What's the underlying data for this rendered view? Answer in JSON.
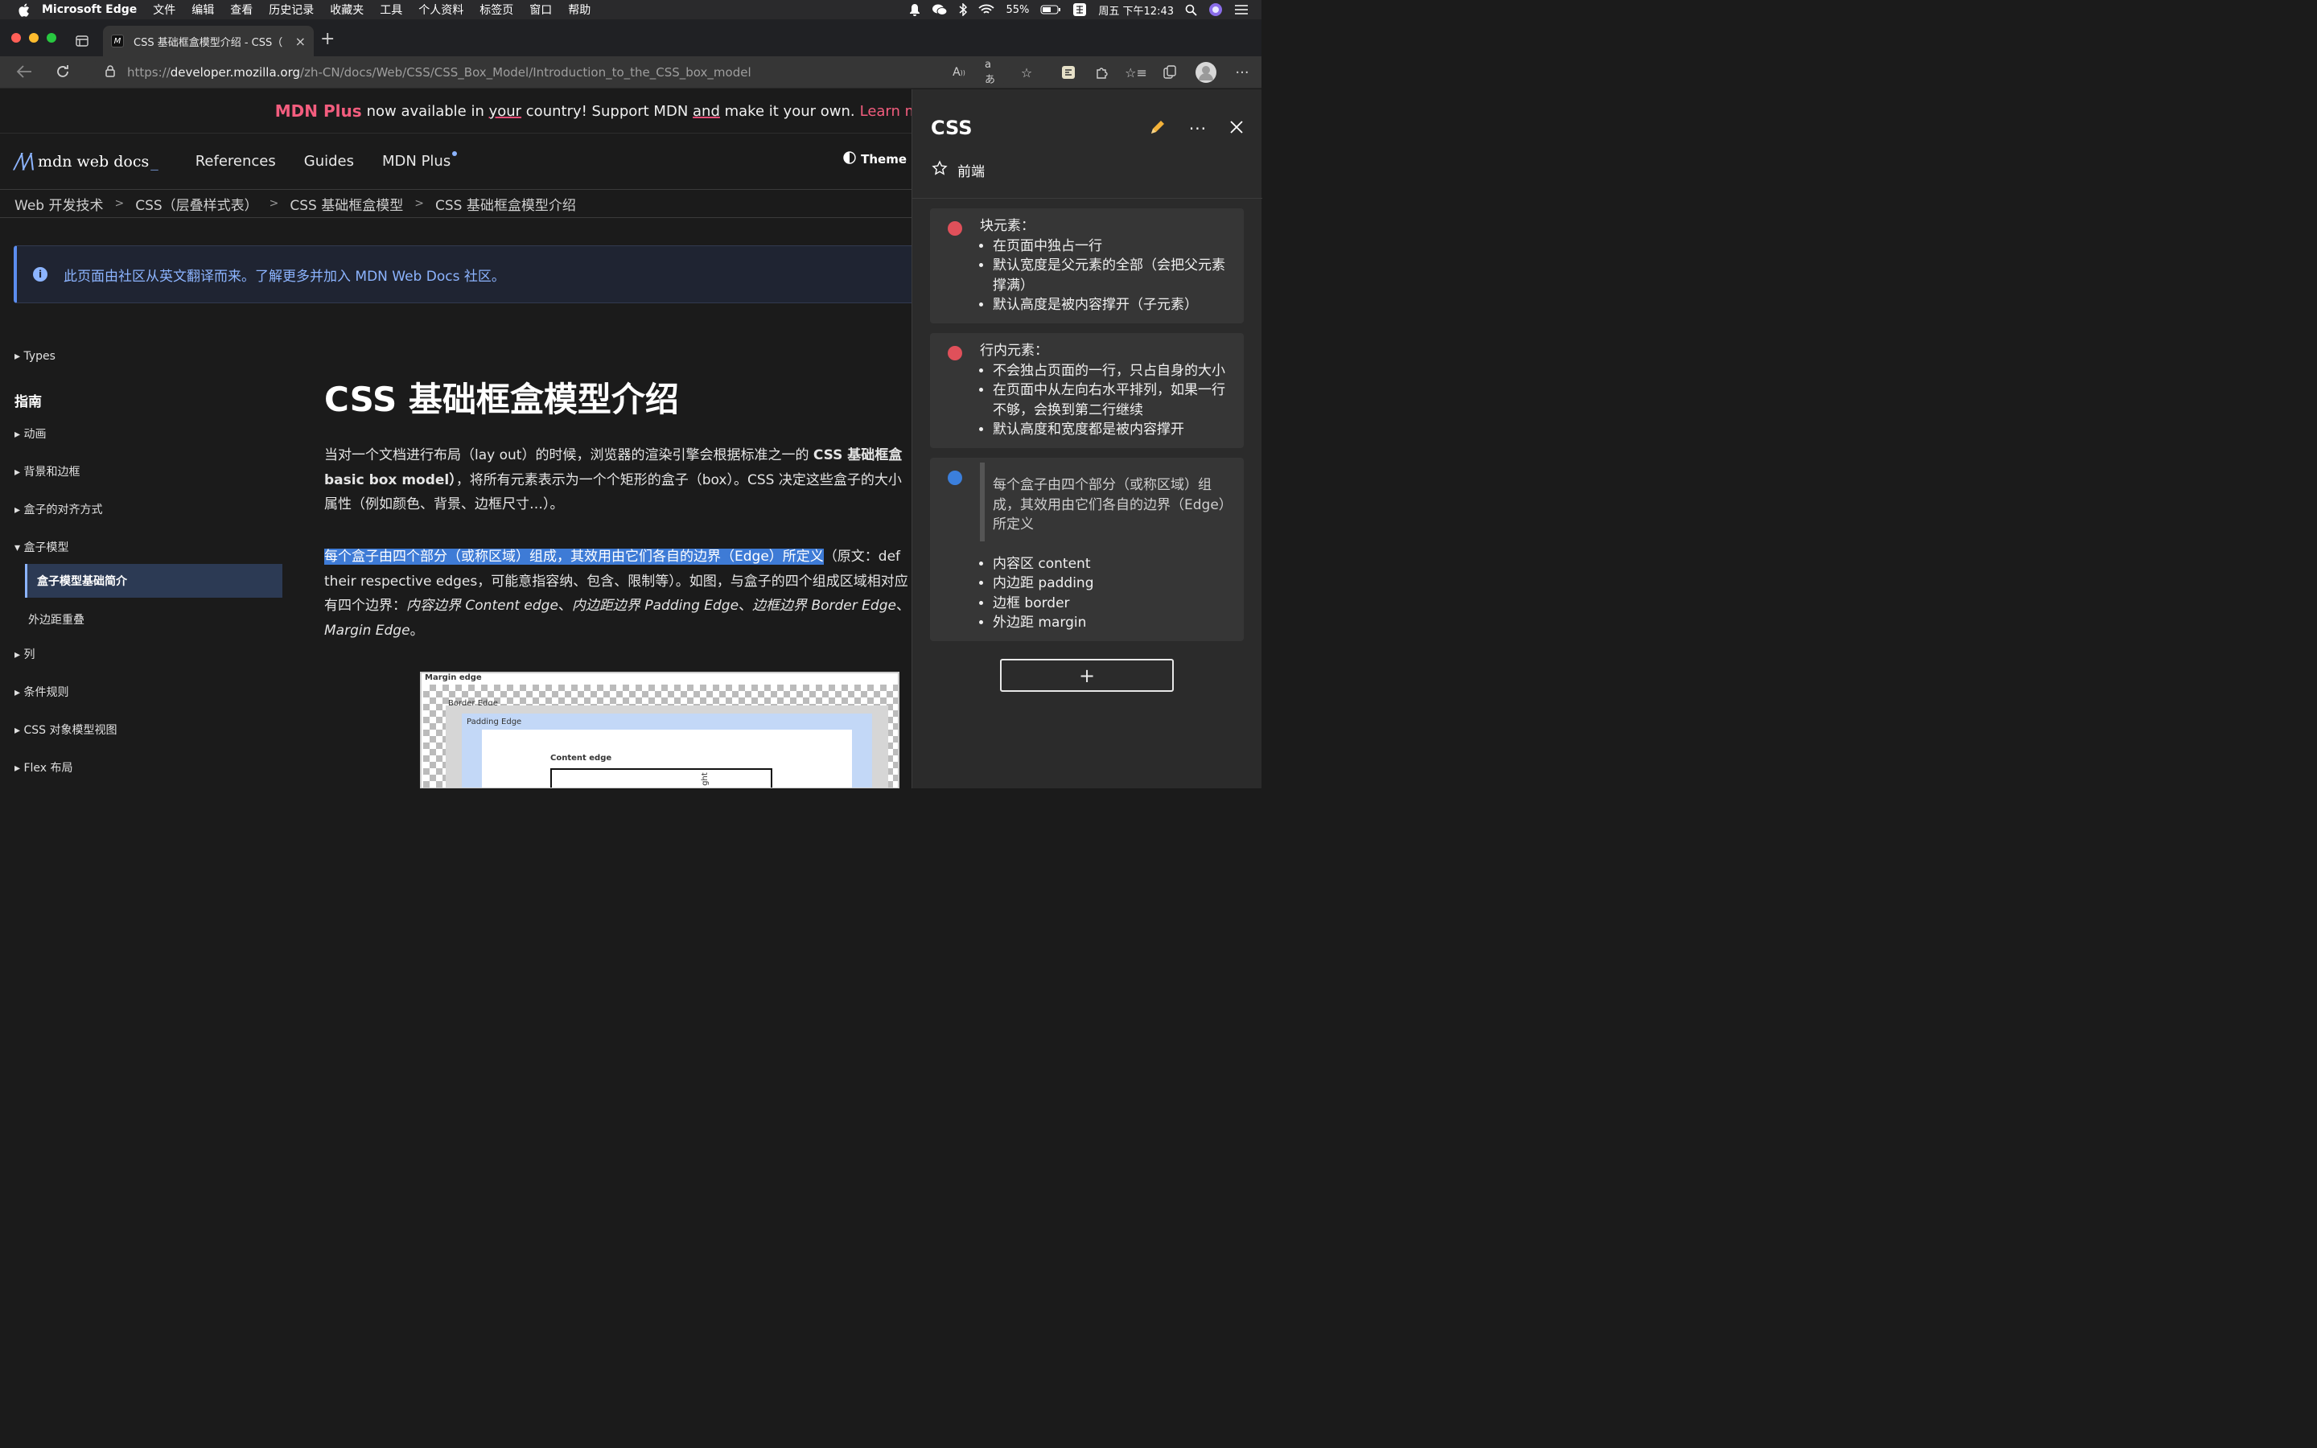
{
  "menubar": {
    "app_name": "Microsoft Edge",
    "items": [
      "文件",
      "编辑",
      "查看",
      "历史记录",
      "收藏夹",
      "工具",
      "个人资料",
      "标签页",
      "窗口",
      "帮助"
    ],
    "battery": "55%",
    "datetime": "周五 下午12:43"
  },
  "browser": {
    "tab_title": "CSS 基础框盒模型介绍 - CSS（",
    "tab_favicon": "M",
    "url_prefix": "https://",
    "url_host": "developer.mozilla.org",
    "url_path": "/zh-CN/docs/Web/CSS/CSS_Box_Model/Introduction_to_the_CSS_box_model"
  },
  "banner": {
    "brand": "MDN Plus",
    "text_1": "now available in ",
    "text_your": "your",
    "text_2": " country! Support MDN ",
    "text_and": "and",
    "text_3": " make it your own.",
    "link": "Learn more"
  },
  "header": {
    "logo_text": "mdn web docs",
    "nav": [
      "References",
      "Guides",
      "MDN Plus"
    ],
    "theme": "Theme"
  },
  "breadcrumbs": [
    "Web 开发技术",
    "CSS（层叠样式表）",
    "CSS 基础框盒模型",
    "CSS 基础框盒模型介绍"
  ],
  "notice": "此页面由社区从英文翻译而来。了解更多并加入 MDN Web Docs 社区。",
  "sidebar": {
    "types": "Types",
    "heading": "指南",
    "items": [
      "动画",
      "背景和边框",
      "盒子的对齐方式",
      "盒子模型",
      "盒子模型基础简介",
      "外边距重叠",
      "列",
      "条件规则",
      "CSS 对象模型视图",
      "Flex 布局"
    ]
  },
  "article": {
    "title": "CSS 基础框盒模型介绍",
    "p1_line1_a": "当对一个文档进行布局（lay out）的时候，浏览器的渲染引擎会根据标准之一的 ",
    "p1_line1_b": "CSS 基础框盒",
    "p1_line2_a": "basic box model）",
    "p1_line2_b": "，将所有元素表示为一个个矩形的盒子（box）。CSS 决定这些盒子的大小",
    "p1_line3": "属性（例如颜色、背景、边框尺寸…）。",
    "p2_highlight": "每个盒子由四个部分（或称区域）组成，其效用由它们各自的边界（Edge）所定义",
    "p2_line1_rest": "（原文：def",
    "p2_line2": "their respective edges，可能意指容纳、包含、限制等）。如图，与盒子的四个组成区域相对应",
    "p2_line3_a": "有四个边界：",
    "p2_line3_b": "内容边界 Content edge",
    "p2_line3_c": "、",
    "p2_line3_d": "内边距边界 Padding Edge",
    "p2_line3_e": "边框边界 Border Edge",
    "p2_line3_f": "、",
    "p2_line4": "Margin Edge",
    "p2_line4_end": "。",
    "diagram_labels": [
      "Margin edge",
      "Border Edge",
      "Padding Edge",
      "Content edge",
      "ght"
    ]
  },
  "collection": {
    "title": "CSS",
    "subtitle": "前端",
    "cards": [
      {
        "color": "#e0505a",
        "heading": "块元素：",
        "items": [
          "在页面中独占一行",
          "默认宽度是父元素的全部（会把父元素撑满）",
          "默认高度是被内容撑开（子元素）"
        ]
      },
      {
        "color": "#e0505a",
        "heading": "行内元素：",
        "items": [
          "不会独占页面的一行，只占自身的大小",
          "在页面中从左向右水平排列，如果一行不够，会换到第二行继续",
          "默认高度和宽度都是被内容撑开"
        ]
      },
      {
        "color": "#3b7fdc",
        "quote": "每个盒子由四个部分（或称区域）组成，其效用由它们各自的边界（Edge）所定义",
        "items": [
          "内容区 content",
          "内边距 padding",
          "边框 border",
          "外边距 margin"
        ]
      }
    ],
    "add_label": "+"
  }
}
